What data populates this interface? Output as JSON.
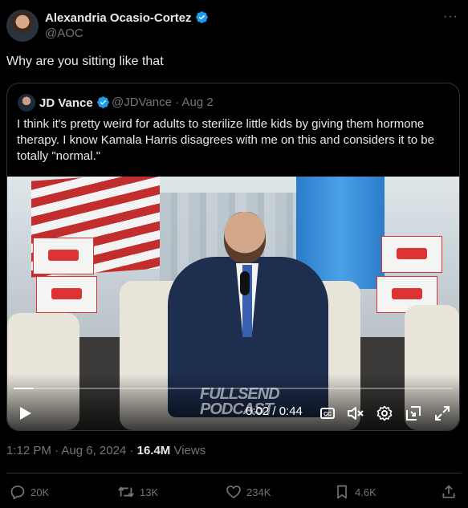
{
  "tweet": {
    "author_name": "Alexandria Ocasio-Cortez",
    "author_handle": "@AOC",
    "text": "Why are you sitting like that"
  },
  "quote": {
    "author_name": "JD Vance",
    "author_handle": "@JDVance · Aug 2",
    "text": "I think it's pretty weird for adults to sterilize little kids by giving them hormone therapy. I know Kamala Harris disagrees with me on this and considers it to be totally \"normal.\"",
    "video": {
      "time_display": "0:02 / 0:44",
      "progress": 0.045,
      "watermark_line1": "FULLSEND",
      "watermark_line2": "PODCAST"
    }
  },
  "meta": {
    "timestamp": "1:12 PM · Aug 6, 2024 · ",
    "views_count": "16.4M",
    "views_label": " Views"
  },
  "actions": {
    "replies": "20K",
    "reposts": "13K",
    "likes": "234K",
    "bookmarks": "4.6K"
  },
  "colors": {
    "verified": "#1d9bf0",
    "text": "#e7e9ea",
    "muted": "#71767b",
    "border": "#2f3336"
  }
}
